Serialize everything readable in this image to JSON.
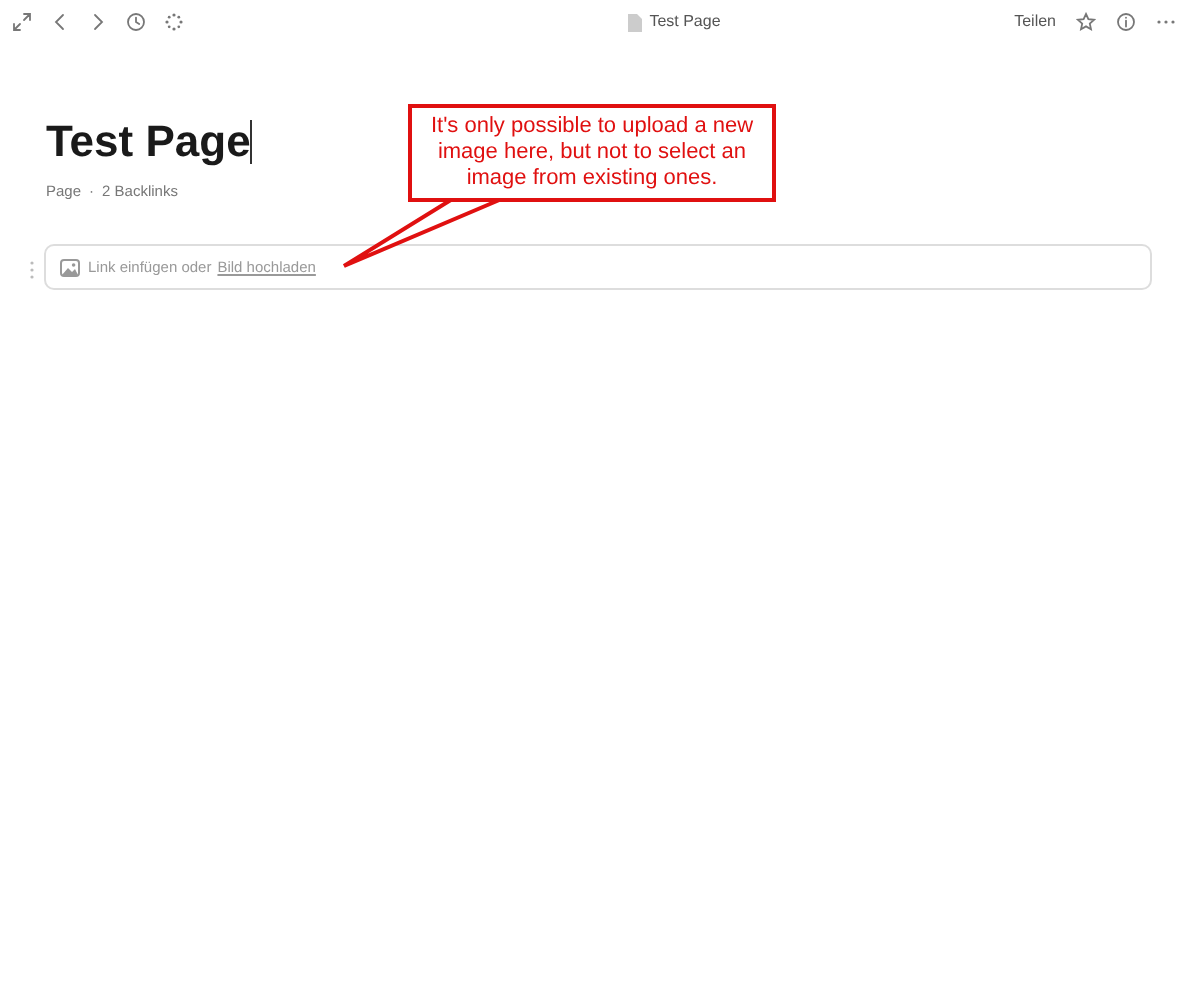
{
  "top_bar": {
    "document_title": "Test Page",
    "share_button": "Teilen"
  },
  "page": {
    "title": "Test Page",
    "meta": [
      "Page",
      "2 Backlinks"
    ],
    "meta_separator": "·"
  },
  "embed_block": {
    "prompt": "Link einfügen oder",
    "link": "Bild hochladen"
  },
  "annotation": {
    "text": "It's only possible to upload a new image here, but not to select an image from existing ones."
  }
}
